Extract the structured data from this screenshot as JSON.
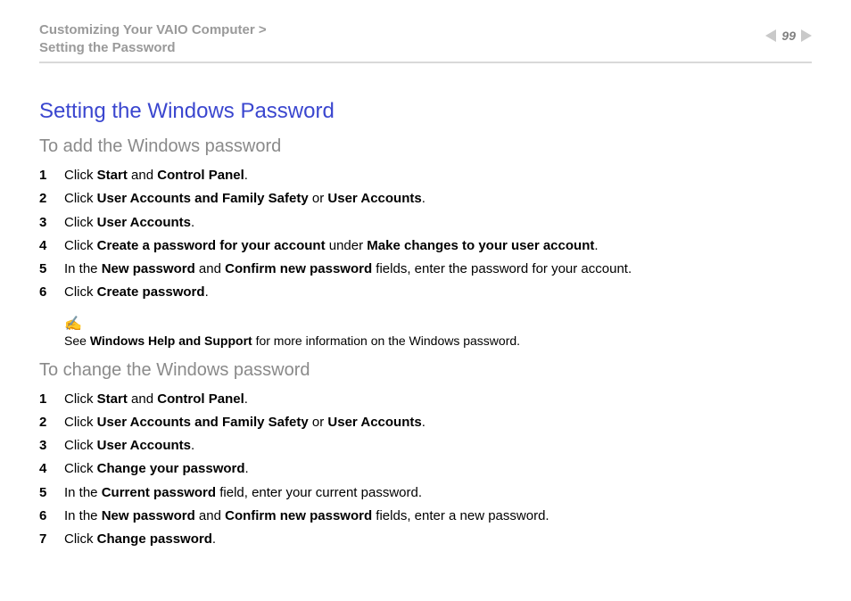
{
  "header": {
    "breadcrumb_top": "Customizing Your VAIO Computer >",
    "breadcrumb_bottom": "Setting the Password",
    "page_number": "99"
  },
  "title": "Setting the Windows Password",
  "section_add": {
    "heading": "To add the Windows password",
    "steps": [
      "Click <b>Start</b> and <b>Control Panel</b>.",
      "Click <b>User Accounts and Family Safety</b> or <b>User Accounts</b>.",
      "Click <b>User Accounts</b>.",
      "Click <b>Create a password for your account</b> under <b>Make changes to your user account</b>.",
      "In the <b>New password</b> and <b>Confirm new password</b> fields, enter the password for your account.",
      "Click <b>Create password</b>."
    ]
  },
  "note": {
    "icon": "✍",
    "text": "See <b>Windows Help and Support</b> for more information on the Windows password."
  },
  "section_change": {
    "heading": "To change the Windows password",
    "steps": [
      "Click <b>Start</b> and <b>Control Panel</b>.",
      "Click <b>User Accounts and Family Safety</b> or <b>User Accounts</b>.",
      "Click <b>User Accounts</b>.",
      "Click <b>Change your password</b>.",
      "In the <b>Current password</b> field, enter your current password.",
      "In the <b>New password</b> and <b>Confirm new password</b> fields, enter a new password.",
      "Click <b>Change password</b>."
    ]
  }
}
